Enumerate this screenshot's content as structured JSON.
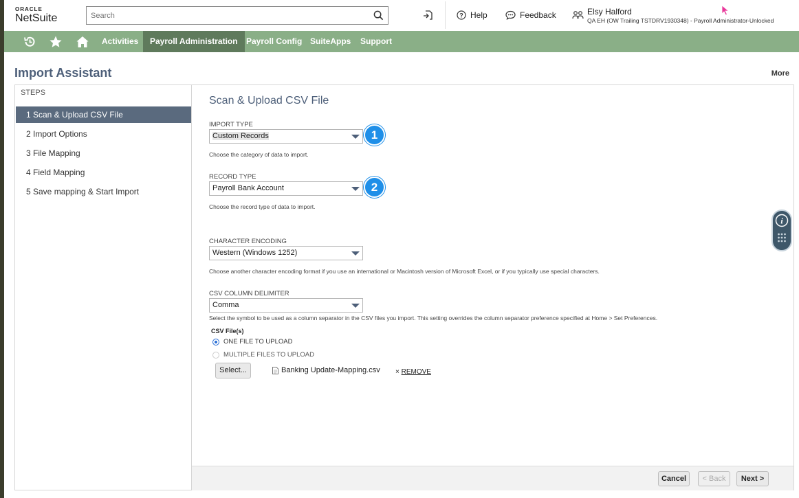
{
  "header": {
    "logo_top": "ORACLE",
    "logo_main": "NetSuite",
    "search_placeholder": "Search",
    "help_label": "Help",
    "feedback_label": "Feedback",
    "user_name": "Elsy Halford",
    "user_role": "QA EH (OW Trailing TSTDRV1930348) - Payroll Administrator-Unlocked"
  },
  "nav": {
    "items": [
      "Activities",
      "Payroll Administration",
      "Payroll Config",
      "SuiteApps",
      "Support"
    ],
    "active": "Payroll Administration"
  },
  "page": {
    "title": "Import Assistant",
    "more_label": "More"
  },
  "steps": {
    "header": "STEPS",
    "items": [
      "1 Scan & Upload CSV File",
      "2 Import Options",
      "3 File Mapping",
      "4 Field Mapping",
      "5 Save mapping & Start Import"
    ]
  },
  "form": {
    "title": "Scan & Upload CSV File",
    "import_type": {
      "label": "IMPORT TYPE",
      "value": "Custom Records",
      "help": "Choose the category of data to import.",
      "badge": "1"
    },
    "record_type": {
      "label": "RECORD TYPE",
      "value": "Payroll Bank Account",
      "help": "Choose the record type of data to import.",
      "badge": "2"
    },
    "encoding": {
      "label": "CHARACTER ENCODING",
      "value": "Western (Windows 1252)",
      "help": "Choose another character encoding format if you use an international or Macintosh version of Microsoft Excel, or if you typically use special characters."
    },
    "delimiter": {
      "label": "CSV COLUMN DELIMITER",
      "value": "Comma",
      "help": "Select the symbol to be used as a column separator in the CSV files you import. This setting overrides the column separator preference specified at Home > Set Preferences."
    },
    "csv_files": {
      "label": "CSV File(s)",
      "option_one": "ONE FILE TO UPLOAD",
      "option_multiple": "MULTIPLE FILES TO UPLOAD",
      "select_label": "Select...",
      "file_name": "Banking Update-Mapping.csv",
      "remove_x": "×",
      "remove_label": "REMOVE"
    }
  },
  "footer": {
    "cancel": "Cancel",
    "back": "< Back",
    "next": "Next >"
  },
  "colors": {
    "nav_bg": "#8aaf87",
    "nav_active": "#5f7a5c",
    "title": "#4d5f79",
    "step_active": "#5a6a7e",
    "badge": "#1f8fe8"
  }
}
